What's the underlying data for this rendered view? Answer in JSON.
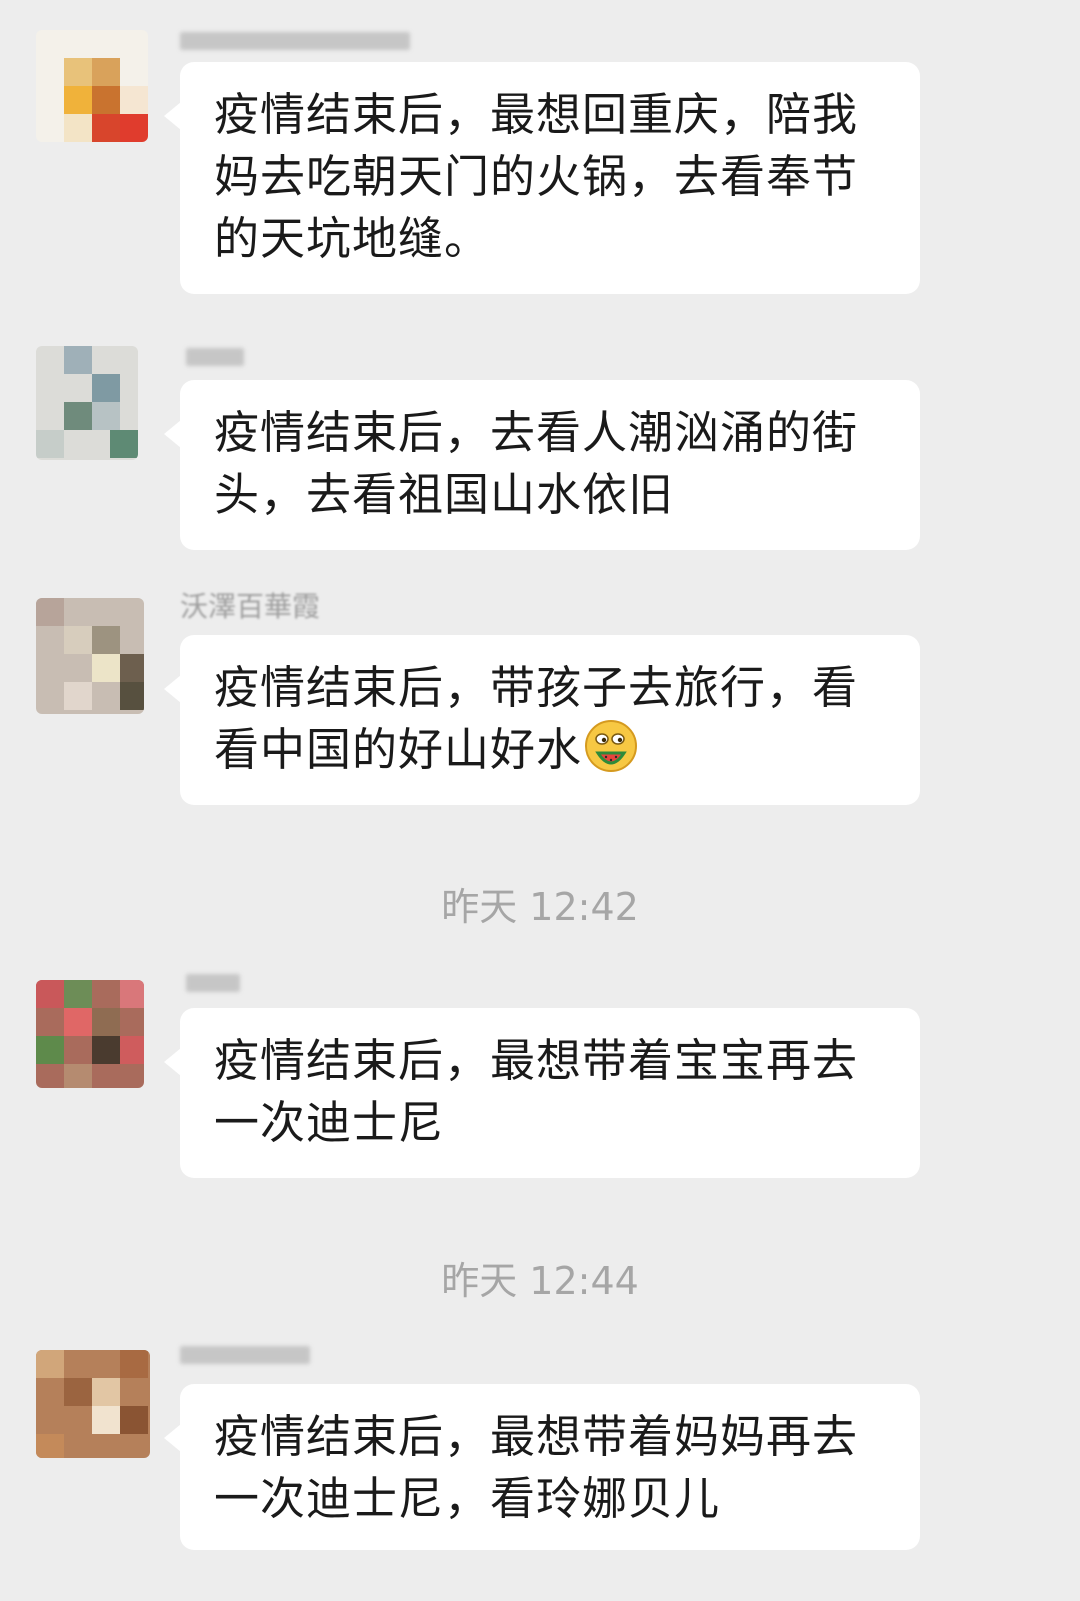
{
  "messages": [
    {
      "text": "疫情结束后，最想回重庆，陪我妈去吃朝天门的火锅，去看奉节的天坑地缝。"
    },
    {
      "text": "疫情结束后，去看人潮汹涌的街头，去看祖国山水依旧"
    },
    {
      "sender": "沃澤百華霞",
      "text": "疫情结束后，带孩子去旅行，看看中国的好山好水",
      "emoji": "watermelon-face-emoji"
    },
    {
      "text": "疫情结束后，最想带着宝宝再去一次迪士尼"
    },
    {
      "text": "疫情结束后，最想带着妈妈再去一次迪士尼，看玲娜贝儿"
    }
  ],
  "timestamps": [
    {
      "text": "昨天 12:42"
    },
    {
      "text": "昨天 12:44"
    }
  ],
  "colors": {
    "background": "#ededed",
    "bubble": "#ffffff",
    "text": "#1a1a1a",
    "timestamp": "#a6a6a6"
  }
}
